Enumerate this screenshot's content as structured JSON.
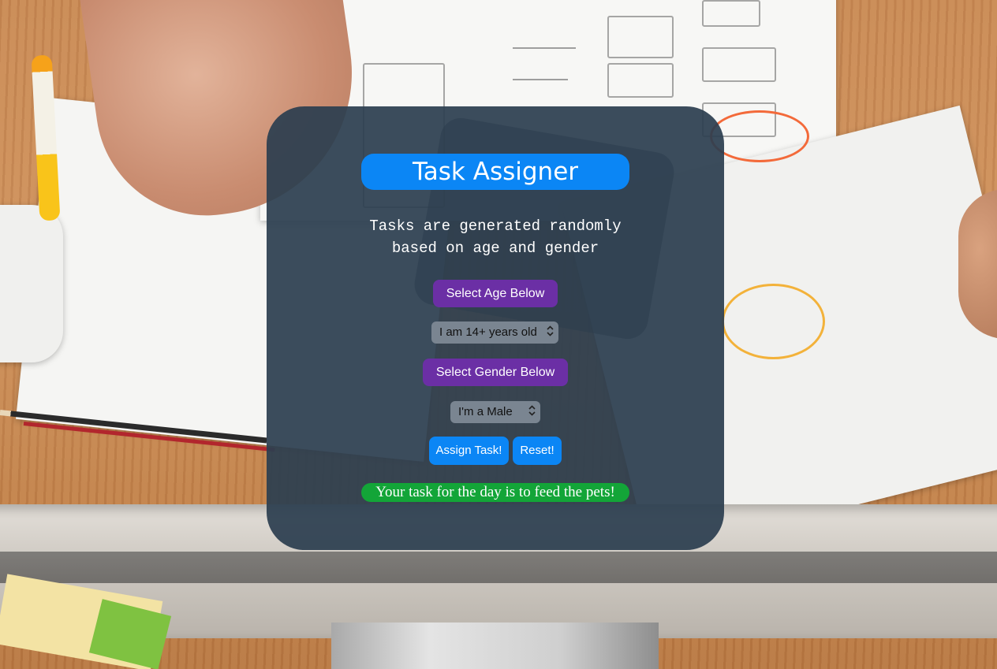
{
  "app": {
    "title": "Task Assigner",
    "subtitle": "Tasks are generated randomly\nbased on age and gender"
  },
  "age": {
    "label": "Select Age Below",
    "selected": "I am 14+ years old"
  },
  "gender": {
    "label": "Select Gender Below",
    "selected": "I'm a Male"
  },
  "actions": {
    "assign_label": "Assign Task!",
    "reset_label": "Reset!"
  },
  "result": {
    "text": "Your task for the day is to feed the pets!"
  },
  "colors": {
    "card_bg": "#2c3e50",
    "title_bg": "#0b86f5",
    "label_bg": "#6b2fa5",
    "select_bg": "#7a8591",
    "button_bg": "#0b86f5",
    "result_bg": "#13a538"
  },
  "icons": {
    "select_chevron": "chevron-up-down-icon"
  }
}
